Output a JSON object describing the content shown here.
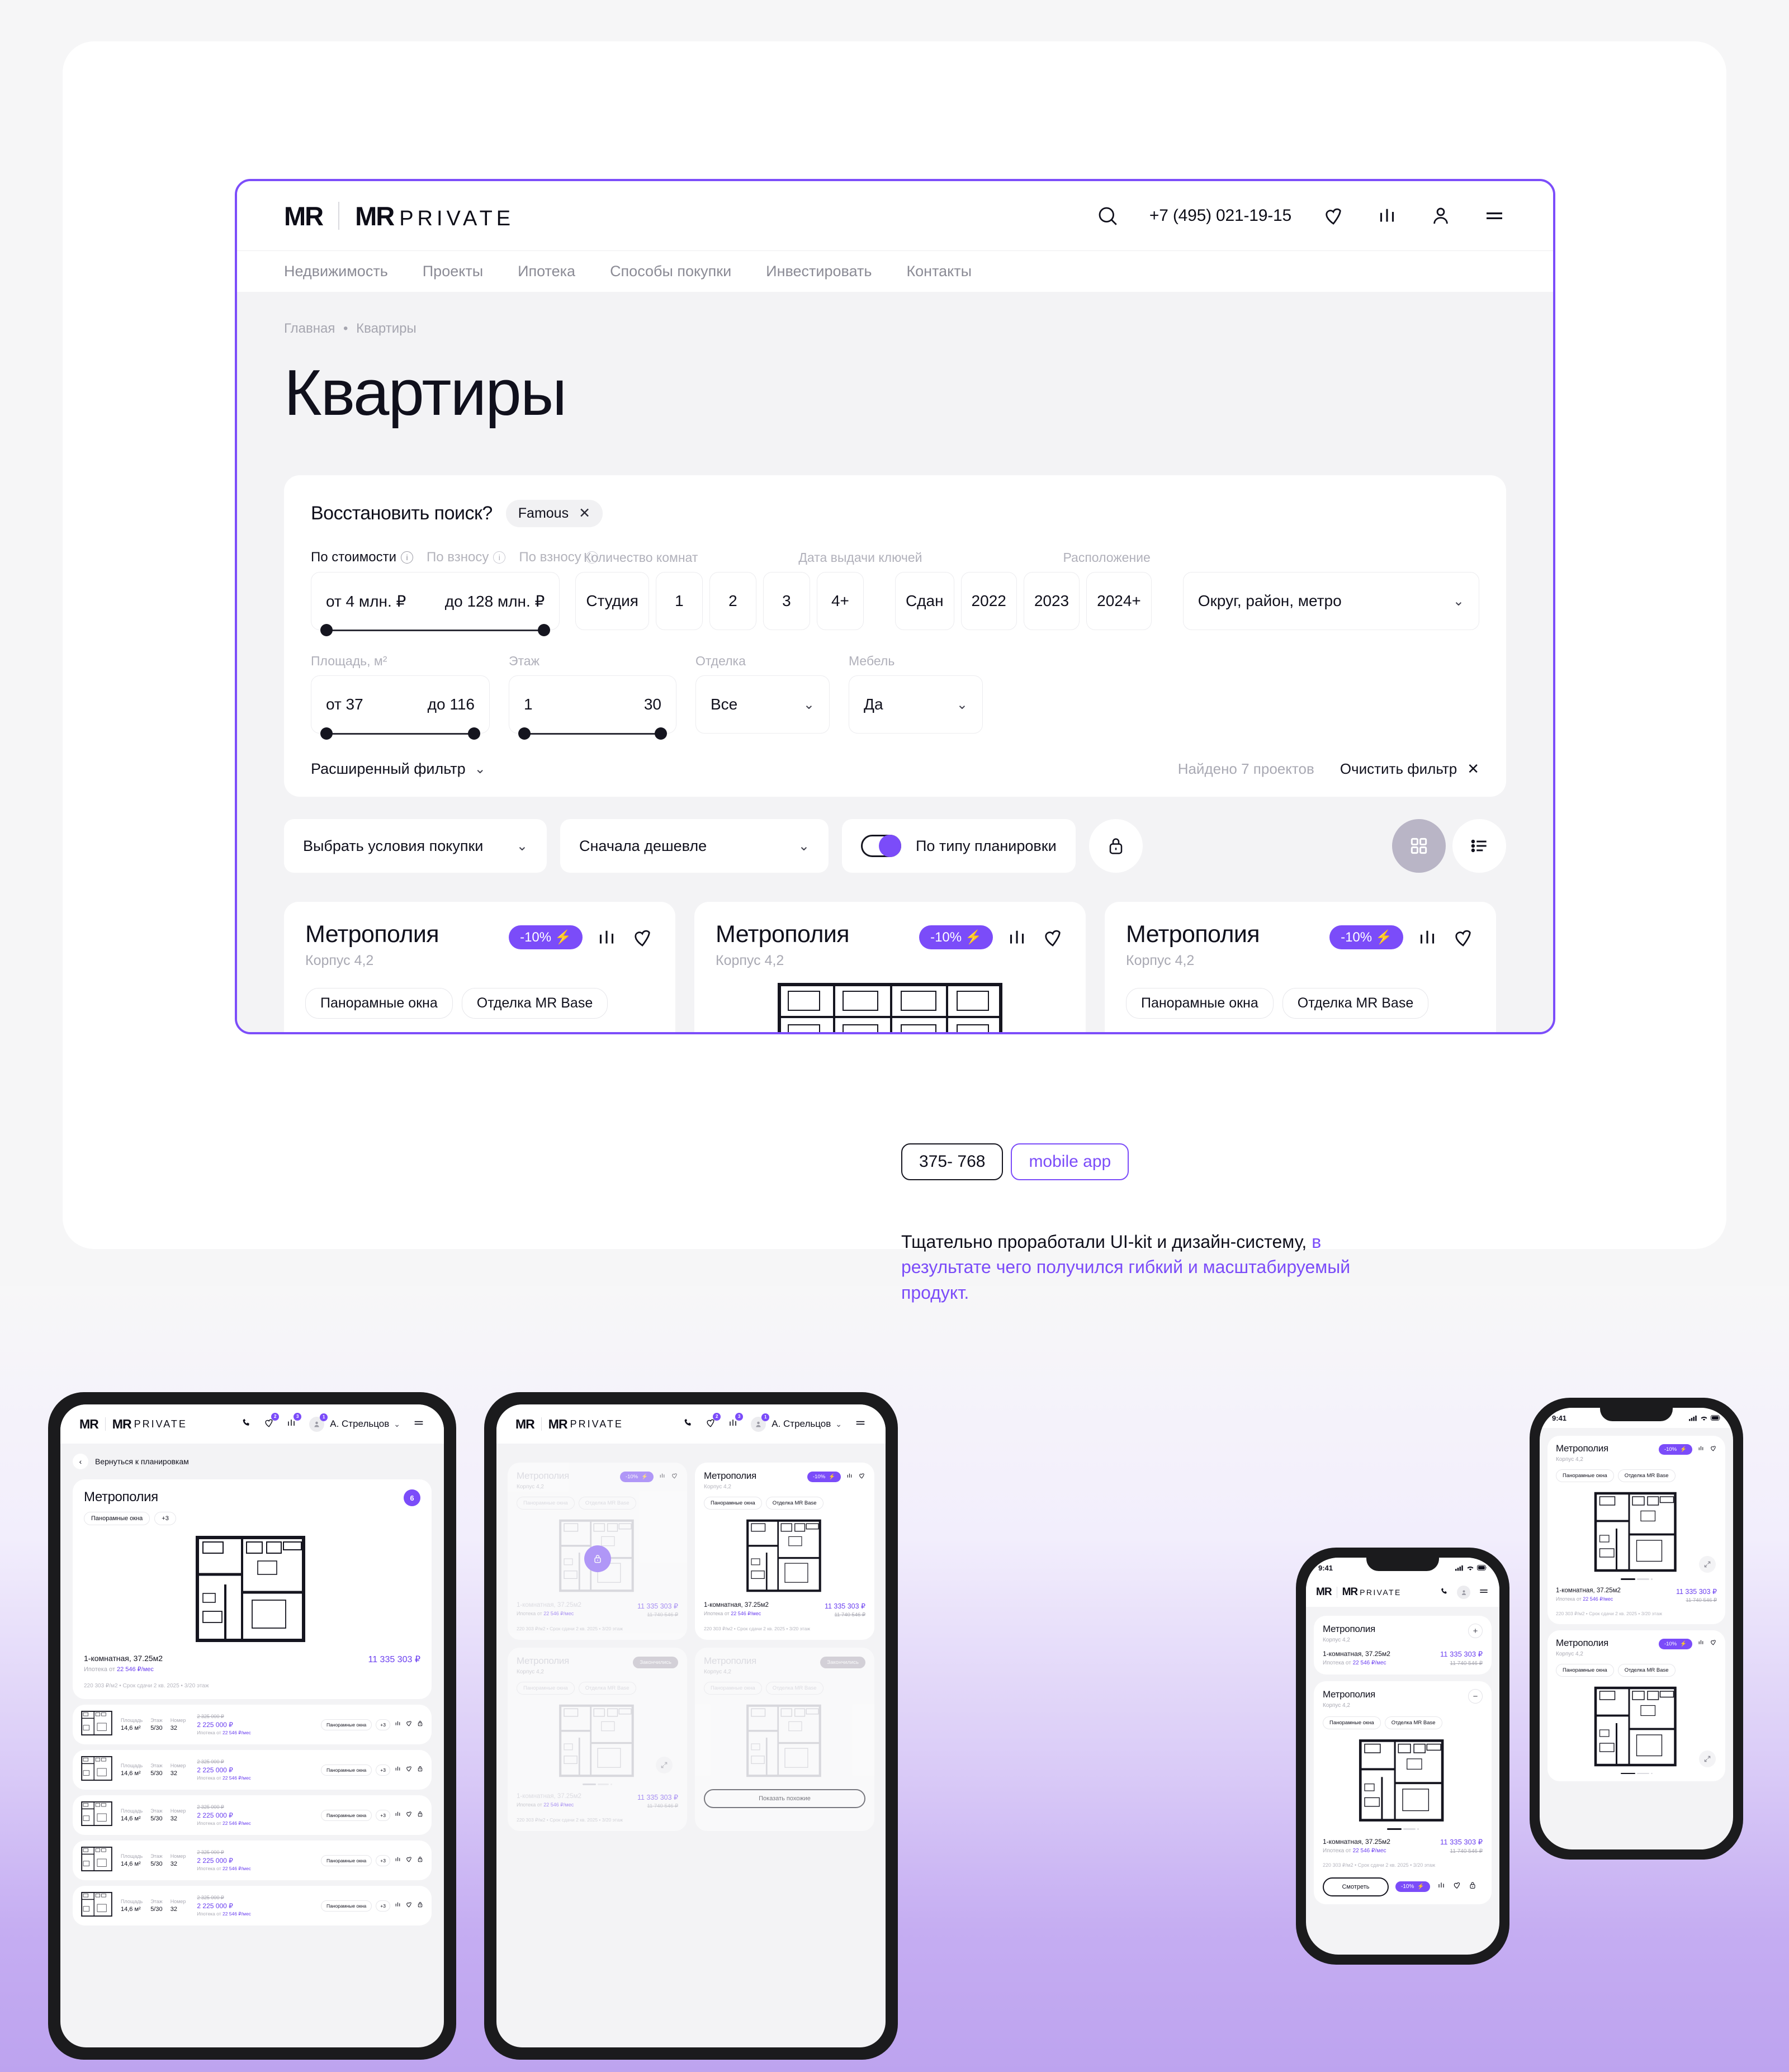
{
  "brand": {
    "logo_short": "MR",
    "logo_main": "MR",
    "logo_sub": "PRIVATE"
  },
  "desktop": {
    "header": {
      "phone": "+7 (495) 021-19-15",
      "icons": [
        "search-icon",
        "heart-icon",
        "compare-icon",
        "user-icon",
        "menu-icon"
      ]
    },
    "nav": [
      "Недвижимость",
      "Проекты",
      "Ипотека",
      "Способы покупки",
      "Инвестировать",
      "Контакты"
    ],
    "breadcrumb": {
      "home": "Главная",
      "sep": "•",
      "current": "Квартиры"
    },
    "page_title": "Квартиры",
    "filter": {
      "restore_label": "Восстановить поиск?",
      "restore_chip": "Famous",
      "restore_chip_close": "✕",
      "tabs": [
        {
          "label": "По стоимости",
          "active": true
        },
        {
          "label": "По взносу",
          "active": false
        },
        {
          "label": "По взносу",
          "active": false
        }
      ],
      "price": {
        "min": "от 4 млн. ₽",
        "max": "до 128 млн. ₽"
      },
      "rooms_label": "Количество комнат",
      "rooms": [
        "Студия",
        "1",
        "2",
        "3",
        "4+"
      ],
      "keys_label": "Дата выдачи ключей",
      "keys": [
        "Сдан",
        "2022",
        "2023",
        "2024+"
      ],
      "location_label": "Расположение",
      "location_value": "Округ, район, метро",
      "area_label": "Площадь, м²",
      "area": {
        "min": "от 37",
        "max": "до 116"
      },
      "floor_label": "Этаж",
      "floor": {
        "min": "1",
        "max": "30"
      },
      "finish_label": "Отделка",
      "finish_value": "Все",
      "furniture_label": "Мебель",
      "furniture_value": "Да",
      "advanced": "Расширенный фильтр",
      "found": "Найдено 7 проектов",
      "clear": "Очистить фильтр",
      "clear_icon": "✕"
    },
    "toolbar": {
      "purchase_conditions": "Выбрать условия покупки",
      "sort": "Сначала дешевле",
      "toggle_label": "По типу планировки",
      "lock_icon": "lock-icon",
      "grid_icon": "grid-view-icon",
      "list_icon": "list-view-icon"
    },
    "cards": [
      {
        "title": "Метрополия",
        "subtitle": "Корпус 4,2",
        "discount": "-10%",
        "chips": [
          "Панорамные окна",
          "Отделка MR Base"
        ],
        "show_chips": true
      },
      {
        "title": "Метрополия",
        "subtitle": "Корпус 4,2",
        "discount": "-10%",
        "chips": [],
        "show_chips": false
      },
      {
        "title": "Метрополия",
        "subtitle": "Корпус 4,2",
        "discount": "-10%",
        "chips": [
          "Панорамные окна",
          "Отделка MR Base"
        ],
        "show_chips": true
      }
    ]
  },
  "annotation": {
    "tag_size": "375- 768",
    "tag_mobile": "mobile app",
    "text_plain": "Тщательно проработали UI-kit и дизайн-систему, ",
    "text_highlight": "в результате чего получился гибкий и масштабируемый продукт."
  },
  "devices": {
    "tablet_list": {
      "header": {
        "user": "А. Стрельцов",
        "badges": {
          "heart": "2",
          "compare": "3",
          "user": "1"
        }
      },
      "back_label": "Вернуться к планировкам",
      "card": {
        "title": "Метрополия",
        "chips": [
          "Панорамные окна",
          "+3"
        ],
        "counter": "6",
        "summary_title": "1-комнатная, 37.25м2",
        "summary_price": "11 335 303 ₽",
        "summary_mortgage_prefix": "Ипотека от ",
        "summary_mortgage_value": "22 546 ₽/мес",
        "meta": "220 303 ₽/м2 • Срок сдачи 2 кв. 2025 • 3/20 этаж"
      },
      "columns": {
        "area": "Площадь",
        "floor": "Этаж",
        "number": "Номер"
      },
      "rows": [
        {
          "area": "14,6 м²",
          "floor": "5/30",
          "number": "32",
          "old_price": "2 325 000 ₽",
          "price": "2 225 000 ₽",
          "mortgage_prefix": "Ипотека от ",
          "mortgage": "22 546 ₽/мес",
          "chip": "Панорамные окна",
          "chip_more": "+3"
        },
        {
          "area": "14,6 м²",
          "floor": "5/30",
          "number": "32",
          "old_price": "2 325 000 ₽",
          "price": "2 225 000 ₽",
          "mortgage_prefix": "Ипотека от ",
          "mortgage": "22 546 ₽/мес",
          "chip": "Панорамные окна",
          "chip_more": "+3"
        },
        {
          "area": "14,6 м²",
          "floor": "5/30",
          "number": "32",
          "old_price": "2 325 000 ₽",
          "price": "2 225 000 ₽",
          "mortgage_prefix": "Ипотека от ",
          "mortgage": "22 546 ₽/мес",
          "chip": "Панорамные окна",
          "chip_more": "+3"
        },
        {
          "area": "14,6 м²",
          "floor": "5/30",
          "number": "32",
          "old_price": "2 325 000 ₽",
          "price": "2 225 000 ₽",
          "mortgage_prefix": "Ипотека от ",
          "mortgage": "22 546 ₽/мес",
          "chip": "Панорамные окна",
          "chip_more": "+3"
        },
        {
          "area": "14,6 м²",
          "floor": "5/30",
          "number": "32",
          "old_price": "2 325 000 ₽",
          "price": "2 225 000 ₽",
          "mortgage_prefix": "Ипотека от ",
          "mortgage": "22 546 ₽/мес",
          "chip": "Панорамные окна",
          "chip_more": "+3"
        }
      ]
    },
    "tablet_grid": {
      "header": {
        "user": "А. Стрельцов",
        "badges": {
          "heart": "2",
          "compare": "3",
          "user": "1"
        }
      },
      "cards": [
        {
          "title": "Метрополия",
          "subtitle": "Корпус 4,2",
          "discount": "-10%",
          "chips": [
            "Панорамные окна",
            "Отделка MR Base"
          ],
          "room": "1-комнатная, 37.25м2",
          "price": "11 335 303 ₽",
          "old_price": "11 740 546 ₽",
          "mortgage_prefix": "Ипотека от ",
          "mortgage": "22 546 ₽/мес",
          "meta": "220 303 ₽/м2 • Срок сдачи 2 кв. 2025 • 3/20 этаж",
          "dim": true,
          "sold": null
        },
        {
          "title": "Метрополия",
          "subtitle": "Корпус 4,2",
          "discount": "-10%",
          "chips": [
            "Панорамные окна",
            "Отделка MR Base"
          ],
          "room": "1-комнатная, 37.25м2",
          "price": "11 335 303 ₽",
          "old_price": "11 740 546 ₽",
          "mortgage_prefix": "Ипотека от ",
          "mortgage": "22 546 ₽/мес",
          "meta": "220 303 ₽/м2 • Срок сдачи 2 кв. 2025 • 3/20 этаж",
          "dim": false,
          "sold": null
        },
        {
          "title": "Метрополия",
          "subtitle": "Корпус 4,2",
          "discount": null,
          "chips": [
            "Панорамные окна",
            "Отделка MR Base"
          ],
          "room": "1-комнатная, 37.25м2",
          "price": "11 335 303 ₽",
          "old_price": "11 740 546 ₽",
          "mortgage_prefix": "Ипотека от ",
          "mortgage": "22 546 ₽/мес",
          "meta": "220 303 ₽/м2 • Срок сдачи 2 кв. 2025 • 3/20 этаж",
          "dim": true,
          "sold": "Закончились"
        },
        {
          "title": "Метрополия",
          "subtitle": "Корпус 4,2",
          "discount": null,
          "chips": [
            "Панорамные окна",
            "Отделка MR Base"
          ],
          "room": "",
          "price": "",
          "old_price": "",
          "mortgage_prefix": "",
          "mortgage": "",
          "meta": "",
          "dim": true,
          "sold": "Закончились"
        }
      ],
      "show_similar": "Показать похожие"
    },
    "phone_center": {
      "status": {
        "time": "9:41"
      },
      "collapsed_card": {
        "title": "Метрополия",
        "subtitle": "Корпус 4,2",
        "room": "1-комнатная, 37.25м2",
        "price": "11 335 303 ₽",
        "old_price": "11 740 546 ₽",
        "mortgage_prefix": "Ипотека от ",
        "mortgage": "22 546 ₽/мес",
        "toggle": "+"
      },
      "expanded_card": {
        "title": "Метрополия",
        "subtitle": "Корпус 4,2",
        "chips": [
          "Панорамные окна",
          "Отделка MR Base"
        ],
        "room": "1-комнатная, 37.25м2",
        "price": "11 335 303 ₽",
        "old_price": "11 740 546 ₽",
        "mortgage_prefix": "Ипотека от ",
        "mortgage": "22 546 ₽/мес",
        "meta": "220 303 ₽/м2 • Срок сдачи 2 кв. 2025 • 3/20 этаж",
        "cta": "Смотреть",
        "discount": "-10%",
        "toggle": "−"
      }
    },
    "phone_right": {
      "status": {
        "time": "9:41"
      },
      "cards": [
        {
          "title": "Метрополия",
          "subtitle": "Корпус 4,2",
          "discount": "-10%",
          "chips": [
            "Панорамные окна",
            "Отделка MR Base"
          ],
          "room": "1-комнатная, 37.25м2",
          "price": "11 335 303 ₽",
          "old_price": "11 740 546 ₽",
          "mortgage_prefix": "Ипотека от ",
          "mortgage": "22 546 ₽/мес",
          "meta": "220 303 ₽/м2 • Срок сдачи 2 кв. 2025 • 3/20 этаж"
        },
        {
          "title": "Метрополия",
          "subtitle": "Корпус 4,2",
          "discount": "-10%",
          "chips": [
            "Панорамные окна",
            "Отделка MR Base"
          ],
          "room": "",
          "price": "",
          "old_price": "",
          "mortgage_prefix": "",
          "mortgage": "",
          "meta": ""
        }
      ]
    }
  },
  "colors": {
    "accent": "#7b4cf9",
    "accent_text": "#6a3ef0",
    "ink": "#10101c",
    "muted": "#a9a9b3",
    "page_bg": "#f3f3f5"
  }
}
